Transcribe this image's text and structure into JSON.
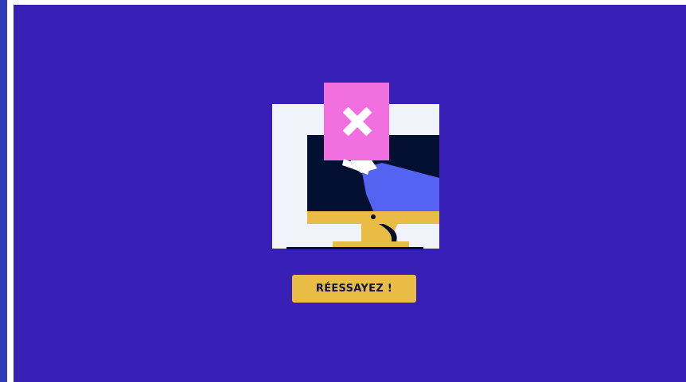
{
  "retry_button": {
    "label": "RÉESSAYEZ !"
  },
  "colors": {
    "background": "#3820b7",
    "accent_button": "#e9bd45",
    "card_pink": "#f26fe0",
    "screen_dark": "#020f31",
    "monitor_frame": "#f1f3fb",
    "sleeve_blue": "#5563f2"
  },
  "illustration": {
    "icon": "monitor-error-icon",
    "card_icon": "close-icon"
  }
}
